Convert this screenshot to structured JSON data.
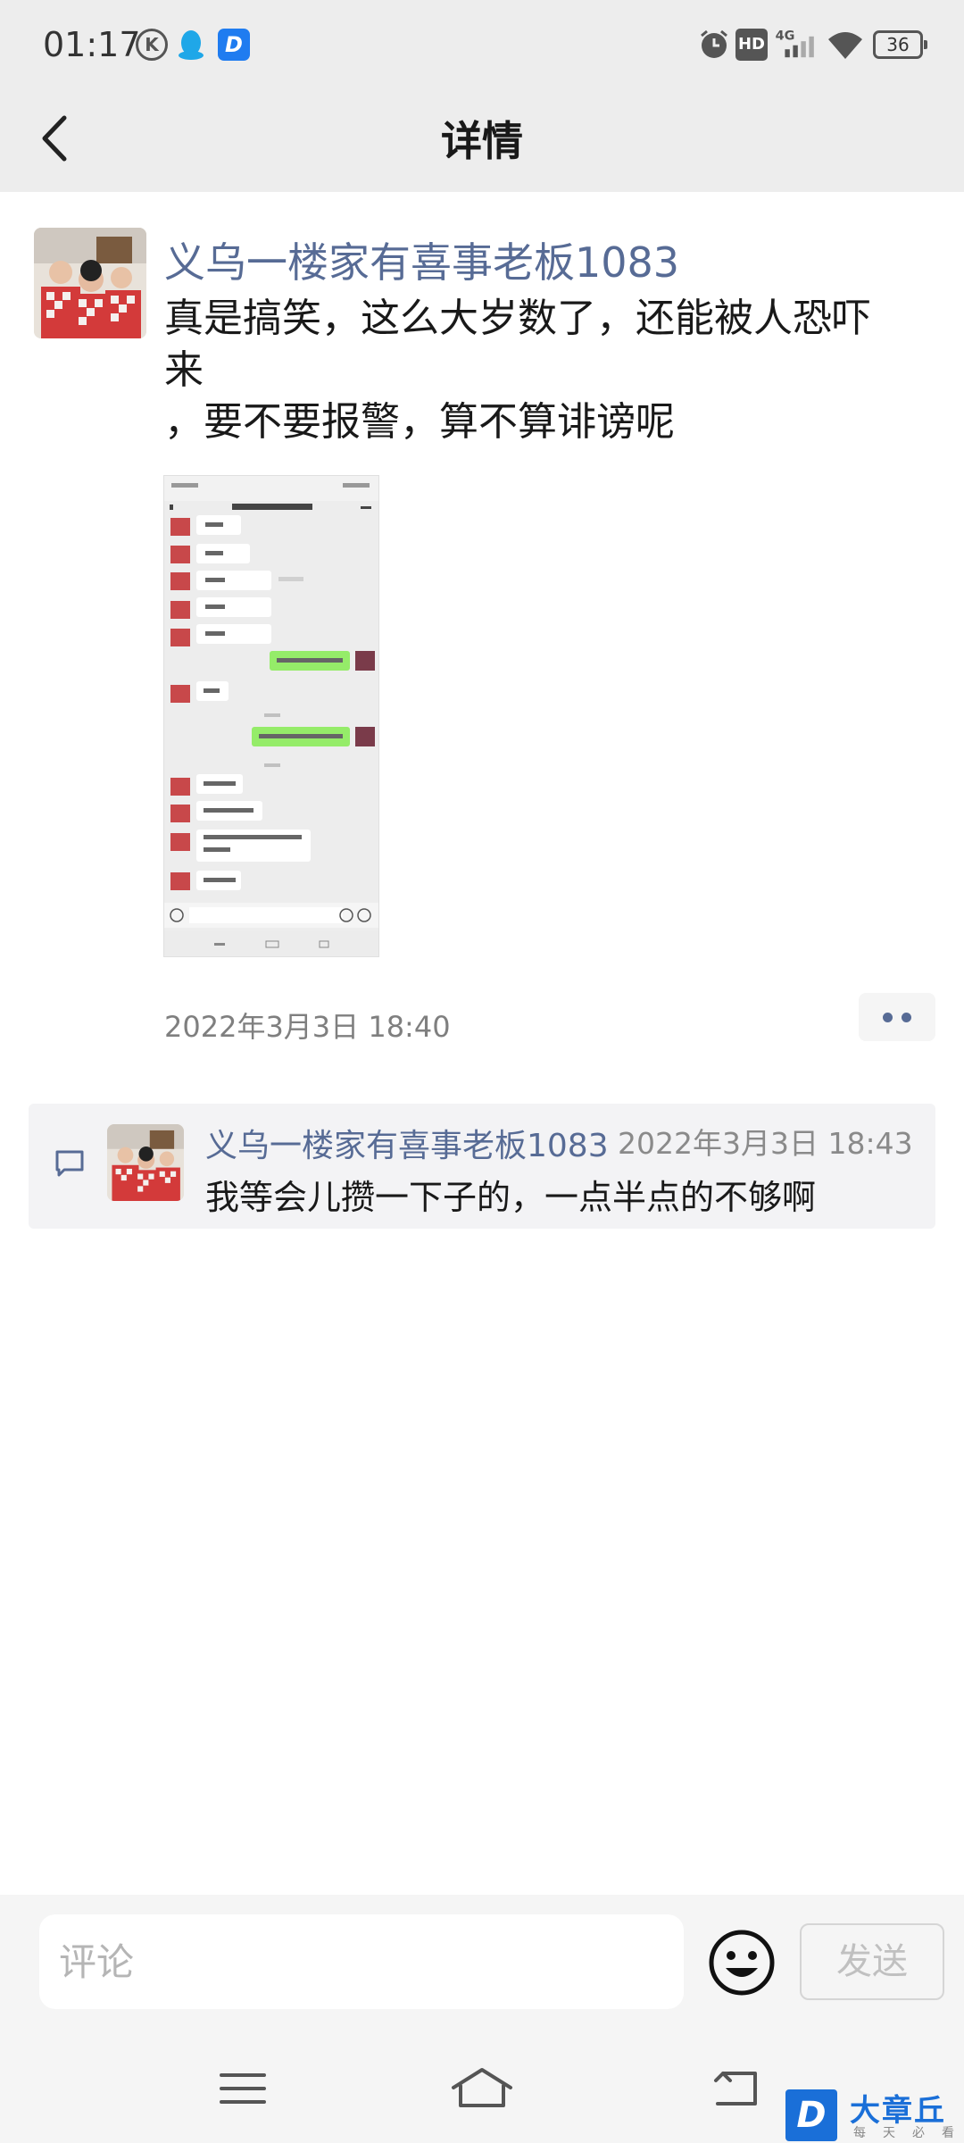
{
  "status_bar": {
    "time": "01:17",
    "k_icon": "K",
    "d_icon": "D",
    "hd_label": "HD",
    "network": "4G",
    "battery": "36"
  },
  "nav": {
    "title": "详情",
    "back_icon": "chevron-left-icon"
  },
  "post": {
    "author": "义乌一楼家有喜事老板1083",
    "text": "真是搞笑，这么大岁数了，还能被人恐吓\n来\n，要不要报警，算不算诽谤呢",
    "timestamp": "2022年3月3日 18:40"
  },
  "comments": [
    {
      "author": "义乌一楼家有喜事老板1083",
      "time": "2022年3月3日 18:43",
      "text": "我等会儿攒一下子的，一点半点的不够啊"
    }
  ],
  "input_bar": {
    "placeholder": "评论",
    "send_label": "发送",
    "emoji_icon": "smiley-face-icon"
  },
  "watermark": {
    "logo_letter": "D",
    "name": "大章丘",
    "slogan": "每天必看"
  }
}
